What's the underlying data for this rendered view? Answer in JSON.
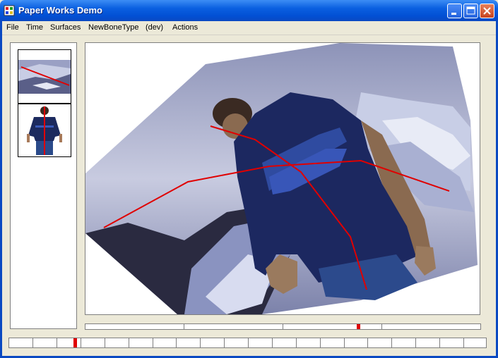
{
  "window": {
    "title": "Paper Works Demo",
    "title_color": "#ffffff",
    "titlebar_color": "#0a5fe0"
  },
  "menu": {
    "items": [
      {
        "label": "File"
      },
      {
        "label": "Time"
      },
      {
        "label": "Surfaces"
      },
      {
        "label": "NewBoneType"
      },
      {
        "label": "(dev)"
      },
      {
        "label": "Actions"
      }
    ]
  },
  "thumbnails": [
    {
      "name": "background-scene"
    },
    {
      "name": "person-figure"
    }
  ],
  "viewer": {
    "bone_color": "#e00000"
  },
  "timeline": {
    "segments": 4,
    "position": 0.69
  },
  "frame_strip": {
    "frames": 20,
    "current_frame": 3
  },
  "icons": {
    "app": "app-icon",
    "minimize": "minimize-icon",
    "maximize": "maximize-icon",
    "close": "close-icon"
  }
}
